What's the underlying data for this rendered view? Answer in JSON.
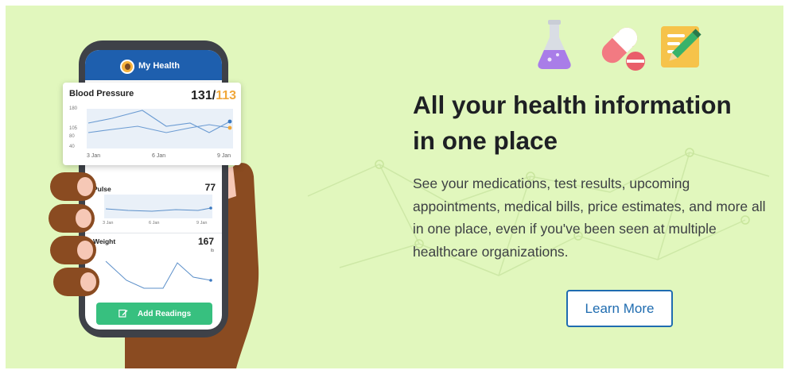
{
  "phone": {
    "header_title": "My Health",
    "blood_pressure": {
      "title": "Blood Pressure",
      "systolic": "131",
      "separator": "/",
      "diastolic": "113",
      "y_ticks": [
        "180",
        "105",
        "80",
        "40"
      ],
      "x_ticks": [
        "3 Jan",
        "6 Jan",
        "9 Jan"
      ]
    },
    "pulse": {
      "title": "Pulse",
      "value": "77",
      "x_ticks": [
        "3 Jan",
        "6 Jan",
        "9 Jan"
      ]
    },
    "weight": {
      "title": "Weight",
      "value": "167",
      "unit": "lb"
    },
    "add_button_label": "Add Readings"
  },
  "icons": [
    "flask-icon",
    "pill-icon",
    "note-pencil-icon"
  ],
  "headline": {
    "line1": "All your health information",
    "line2": "in one place"
  },
  "body": "See your medications, test results, upcoming appointments, medical bills, price estimates, and more all in one place, even if you've been seen at multiple healthcare organizations.",
  "cta_label": "Learn More",
  "colors": {
    "background": "#e1f7bd",
    "headline": "#1e2024",
    "cta": "#1f6cb0",
    "add_button": "#37c07f",
    "phone_header": "#1e5fae",
    "diastolic": "#f0a73a"
  }
}
